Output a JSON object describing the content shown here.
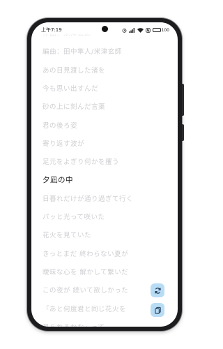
{
  "status_bar": {
    "time": "上午7:19",
    "battery": "100"
  },
  "lyrics": [
    "作曲：米津玄師",
    "編曲：田中隼人/米津玄師",
    "あの日見渡した渚を",
    "今も思い出すんだ",
    "砂の上に刻んだ言葉",
    "君の後ろ姿",
    "寄り返す波が",
    "足元をよぎり何かを攫う",
    "夕凪の中",
    "日暮れだけが通り過ぎて行く",
    "パッと光って咲いた",
    "花火を見ていた",
    "きっとまだ 終わらない夏が",
    "曖昧な心を 解かして繋いだ",
    "この夜が 続いて欲しかった",
    "「あと何度君と同じ花火を",
    "見られるかな」って"
  ],
  "active_lyric_index": 8,
  "buttons": {
    "sync_icon": "sync-icon",
    "copy_icon": "copy-icon"
  }
}
